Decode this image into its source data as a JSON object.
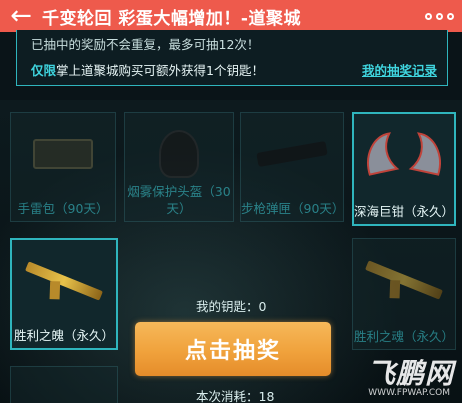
{
  "header": {
    "title": "千变轮回 彩蛋大幅增加！-道聚城",
    "back_icon": "back-arrow-icon",
    "more_icon": "more-dots-icon",
    "bar_color": "#ee5a4c"
  },
  "info": {
    "line1": "已抽中的奖励不会重复，最多可抽12次！",
    "line2_prefix": "仅限",
    "line2_rest": "掌上道聚城购买可额外获得1个钥匙！",
    "record_link": "我的抽奖记录",
    "accent_color": "#3fd4de"
  },
  "items": [
    {
      "label": "手雷包（90天）",
      "state": "drawn"
    },
    {
      "label": "烟雾保护头盔（30天）",
      "state": "drawn"
    },
    {
      "label": "步枪弹匣（90天）",
      "state": "drawn"
    },
    {
      "label": "深海巨钳（永久）",
      "state": "available"
    },
    {
      "label": "胜利之魄（永久）",
      "state": "available"
    },
    {
      "label": "胜利之魂（永久）",
      "state": "drawn"
    }
  ],
  "keys": {
    "label": "我的钥匙：0"
  },
  "draw_button": {
    "label": "点击抽奖"
  },
  "cost": {
    "label": "本次消耗：18"
  },
  "watermark": {
    "brand": "飞鹏网",
    "url": "WWW.FPWAP.COM"
  }
}
